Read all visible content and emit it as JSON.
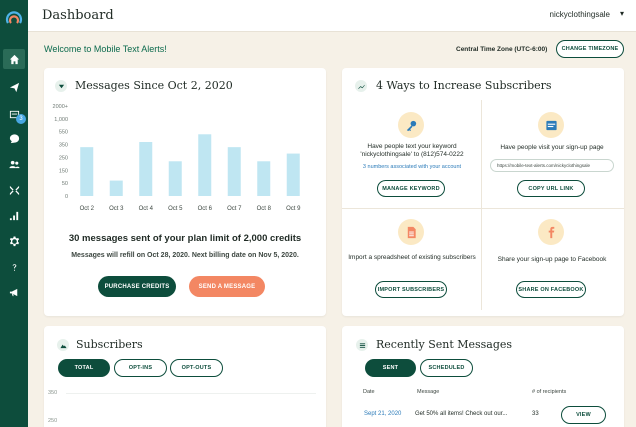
{
  "header": {
    "title": "Dashboard",
    "username": "nickyclothingsale"
  },
  "welcome": {
    "text": "Welcome to Mobile Text Alerts!",
    "timezone": "Central Time Zone (UTC-6:00)",
    "timezone_button": "CHANGE TIMEZONE"
  },
  "sidebar": {
    "badge": "3",
    "items": [
      {
        "name": "home-icon",
        "active": true
      },
      {
        "name": "send-icon"
      },
      {
        "name": "inbox-icon"
      },
      {
        "name": "chat-icon"
      },
      {
        "name": "users-icon"
      },
      {
        "name": "integrations-icon"
      },
      {
        "name": "analytics-icon"
      },
      {
        "name": "settings-icon"
      },
      {
        "name": "help-icon"
      },
      {
        "name": "megaphone-icon"
      }
    ]
  },
  "messages_card": {
    "title": "Messages Since Oct 2, 2020",
    "summary": "30 messages sent of your plan limit of 2,000 credits",
    "refill": "Messages will refill on Oct 28, 2020. Next billing date on Nov 5, 2020.",
    "purchase_button": "PURCHASE CREDITS",
    "send_button": "SEND A MESSAGE"
  },
  "chart_data": {
    "type": "bar",
    "categories": [
      "Oct 2",
      "Oct 3",
      "Oct 4",
      "Oct 5",
      "Oct 6",
      "Oct 7",
      "Oct 8",
      "Oct 9"
    ],
    "values": [
      330,
      70,
      390,
      220,
      510,
      330,
      220,
      280
    ],
    "yticks": [
      "0",
      "50",
      "150",
      "250",
      "350",
      "550",
      "1,000",
      "2000+"
    ],
    "ylim": [
      0,
      2000
    ],
    "bar_color": "#bfe6f2"
  },
  "ways_card": {
    "title": "4 Ways to Increase Subscribers",
    "keyword": {
      "text": "Have people text your keyword 'nickyclothingsale' to (812)574-0222",
      "link": "3 numbers associated with your account",
      "button": "MANAGE KEYWORD"
    },
    "signup": {
      "text": "Have people visit your sign-up page",
      "url": "https://mobile-text-alerts.com/nickyclothingsale",
      "button": "COPY URL LINK"
    },
    "import": {
      "text": "Import a spreadsheet of existing subscribers",
      "button": "IMPORT SUBSCRIBERS"
    },
    "facebook": {
      "text": "Share your sign-up page to Facebook",
      "button": "SHARE ON FACEBOOK"
    }
  },
  "subscribers_card": {
    "title": "Subscribers",
    "tabs": [
      "TOTAL",
      "OPT-INS",
      "OPT-OUTS"
    ],
    "yticks": [
      "350",
      "250"
    ]
  },
  "recent_card": {
    "title": "Recently Sent Messages",
    "tabs": [
      "SENT",
      "SCHEDULED"
    ],
    "columns": [
      "Date",
      "Message",
      "# of recipients"
    ],
    "rows": [
      {
        "date": "Sept 21, 2020",
        "message": "Get 50% all items! Check out our...",
        "recipients": "33",
        "action": "VIEW"
      }
    ]
  }
}
